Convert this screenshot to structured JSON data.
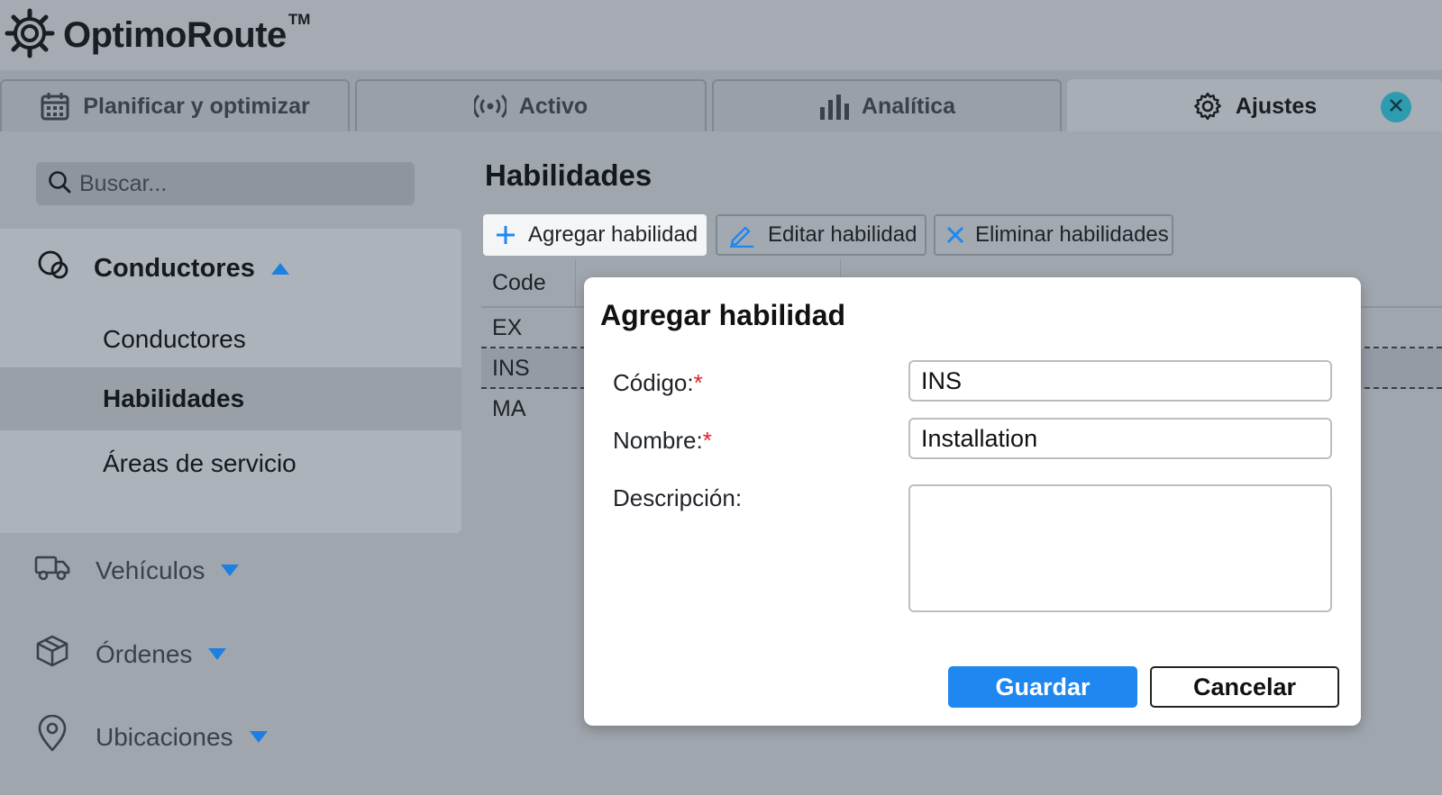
{
  "app": {
    "name": "OptimoRoute",
    "trademark": "TM",
    "icons": {
      "logo": "optimoroute-gear-logo-icon"
    }
  },
  "tabs": [
    {
      "label": "Planificar y optimizar",
      "icon": "calendar-icon",
      "active": false
    },
    {
      "label": "Activo",
      "icon": "broadcast-icon",
      "active": false
    },
    {
      "label": "Analítica",
      "icon": "bar-chart-icon",
      "active": false
    },
    {
      "label": "Ajustes",
      "icon": "gear-icon",
      "active": true
    }
  ],
  "sidebar": {
    "search_placeholder": "Buscar...",
    "sections": [
      {
        "label": "Conductores",
        "icon": "drivers-icon",
        "expanded": true,
        "items": [
          {
            "label": "Conductores",
            "selected": false
          },
          {
            "label": "Habilidades",
            "selected": true
          },
          {
            "label": "Áreas de servicio",
            "selected": false
          }
        ]
      },
      {
        "label": "Vehículos",
        "icon": "truck-icon",
        "expanded": false
      },
      {
        "label": "Órdenes",
        "icon": "package-icon",
        "expanded": false
      },
      {
        "label": "Ubicaciones",
        "icon": "location-pin-icon",
        "expanded": false
      }
    ]
  },
  "main": {
    "title": "Habilidades",
    "toolbar": {
      "add_label": "Agregar habilidad",
      "edit_label": "Editar habilidad",
      "delete_label": "Eliminar habilidades"
    },
    "table": {
      "columns": [
        "Code"
      ],
      "rows": [
        {
          "code": "EX",
          "selected": false
        },
        {
          "code": "INS",
          "selected": true
        },
        {
          "code": "MA",
          "selected": false
        }
      ]
    }
  },
  "modal": {
    "title": "Agregar habilidad",
    "fields": {
      "code_label": "Código:",
      "code_value": "INS",
      "name_label": "Nombre:",
      "name_value": "Installation",
      "description_label": "Descripción:",
      "description_value": "",
      "required_marker": "*"
    },
    "save_label": "Guardar",
    "cancel_label": "Cancelar"
  },
  "colors": {
    "accent": "#1e88f0",
    "required": "#e0202a",
    "close_button": "#2e9bb0"
  }
}
